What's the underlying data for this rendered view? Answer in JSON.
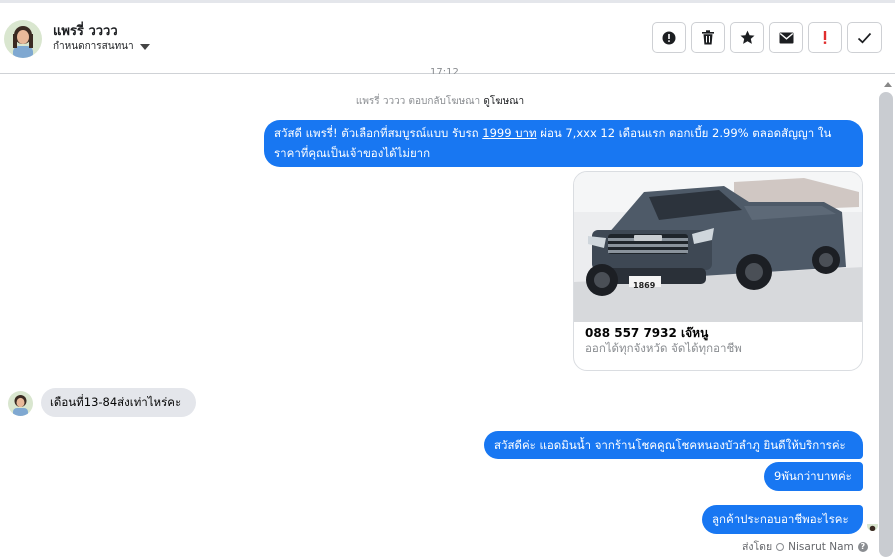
{
  "header": {
    "contact_name": "แพรรี่ วววว",
    "assign_label": "กำหนดการสนทนา",
    "toolbar_icons": [
      "alert-circle-icon",
      "trash-icon",
      "star-icon",
      "mail-icon",
      "exclamation-icon",
      "check-icon"
    ]
  },
  "thread": {
    "time_fragment": "17:12",
    "reply_note": {
      "prefix": "แพรรี่ วววว ตอบกลับโฆษณา",
      "link": "ดูโฆษณา"
    },
    "ad_message": {
      "part1": "สวัสดี แพรรี่! ตัวเลือกที่สมบูรณ์แบบ รับรถ ",
      "price": "1999 บาท",
      "part2": " ผ่อน 7,xxx 12 เดือนแรก ดอกเบี้ย 2.99% ตลอดสัญญา ใน",
      "line2": "ราคาที่คุณเป็นเจ้าของได้ไม่ยาก"
    },
    "ad_card": {
      "image_badge": "1869",
      "title": "088 557 7932 เจ๊หนู",
      "subtitle": "ออกได้ทุกจังหวัด จัดได้ทุกอาชีพ"
    },
    "incoming": [
      {
        "text": "เดือนที่13-84ส่งเท่าไหร่คะ"
      }
    ],
    "outgoing": [
      {
        "text": "สวัสดีค่ะ แอดมินน้ำ จากร้านโชคคูณโชคหนองบัวลำภู ยินดีให้บริการค่ะ"
      },
      {
        "text": "9พันกว่าบาทค่ะ"
      },
      {
        "text": "ลูกค้าประกอบอาชีพอะไรคะ"
      }
    ],
    "sent_by": {
      "label": "ส่งโดย",
      "name": "Nisarut Nam"
    }
  },
  "colors": {
    "accent": "#1877f2",
    "incoming_bubble": "#e4e6eb",
    "exclamation": "#e02d2d"
  }
}
